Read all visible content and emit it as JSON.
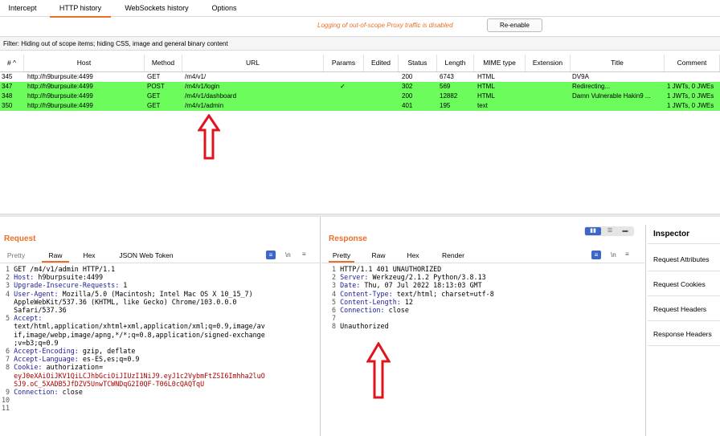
{
  "tabs": [
    "Intercept",
    "HTTP history",
    "WebSockets history",
    "Options"
  ],
  "info": {
    "warning": "Logging of out-of-scope Proxy traffic is disabled",
    "reenable": "Re-enable"
  },
  "filter": "Filter: Hiding out of scope items;  hiding CSS, image and general binary content",
  "columns": [
    "# ^",
    "Host",
    "Method",
    "URL",
    "Params",
    "Edited",
    "Status",
    "Length",
    "MIME type",
    "Extension",
    "Title",
    "Comment"
  ],
  "rows": [
    {
      "num": "345",
      "host": "http://h9burpsuite:4499",
      "method": "GET",
      "url": "/m4/v1/",
      "params": "",
      "edited": "",
      "status": "200",
      "length": "6743",
      "mime": "HTML",
      "ext": "",
      "title": "DV9A",
      "comment": ""
    },
    {
      "num": "347",
      "host": "http://h9burpsuite:4499",
      "method": "POST",
      "url": "/m4/v1/login",
      "params": "✓",
      "edited": "",
      "status": "302",
      "length": "569",
      "mime": "HTML",
      "ext": "",
      "title": "Redirecting...",
      "comment": "1 JWTs, 0 JWEs"
    },
    {
      "num": "348",
      "host": "http://h9burpsuite:4499",
      "method": "GET",
      "url": "/m4/v1/dashboard",
      "params": "",
      "edited": "",
      "status": "200",
      "length": "12882",
      "mime": "HTML",
      "ext": "",
      "title": "Damn Vulnerable Hakin9 ...",
      "comment": "1 JWTs, 0 JWEs"
    },
    {
      "num": "350",
      "host": "http://h9burpsuite:4499",
      "method": "GET",
      "url": "/m4/v1/admin",
      "params": "",
      "edited": "",
      "status": "401",
      "length": "195",
      "mime": "text",
      "ext": "",
      "title": "",
      "comment": "1 JWTs, 0 JWEs"
    }
  ],
  "request": {
    "title": "Request",
    "tabs": [
      "Pretty",
      "Raw",
      "Hex",
      "JSON Web Token"
    ],
    "newline_label": "\\n",
    "menu_glyph": "≡",
    "lines": [
      {
        "n": "1",
        "k": "",
        "v": "GET /m4/v1/admin HTTP/1.1"
      },
      {
        "n": "2",
        "k": "Host:",
        "v": " h9burpsuite:4499"
      },
      {
        "n": "3",
        "k": "Upgrade-Insecure-Requests:",
        "v": " 1"
      },
      {
        "n": "4",
        "k": "User-Agent:",
        "v": " Mozilla/5.0 (Macintosh; Intel Mac OS X 10_15_7)"
      },
      {
        "n": "",
        "k": "",
        "v": "AppleWebKit/537.36 (KHTML, like Gecko) Chrome/103.0.0.0"
      },
      {
        "n": "",
        "k": "",
        "v": "Safari/537.36"
      },
      {
        "n": "5",
        "k": "Accept:",
        "v": ""
      },
      {
        "n": "",
        "k": "",
        "v": "text/html,application/xhtml+xml,application/xml;q=0.9,image/av"
      },
      {
        "n": "",
        "k": "",
        "v": "if,image/webp,image/apng,*/*;q=0.8,application/signed-exchange"
      },
      {
        "n": "",
        "k": "",
        "v": ";v=b3;q=0.9"
      },
      {
        "n": "6",
        "k": "Accept-Encoding:",
        "v": " gzip, deflate"
      },
      {
        "n": "7",
        "k": "Accept-Language:",
        "v": " es-ES,es;q=0.9"
      },
      {
        "n": "8",
        "k": "Cookie:",
        "v": " authorization="
      },
      {
        "n": "",
        "k": "",
        "v": "eyJ0eXAiOiJKV1QiLCJhbGciOiJIUzI1NiJ9.eyJ1c2VybmFtZSI6Imhha2luO",
        "red": true
      },
      {
        "n": "",
        "k": "",
        "v": "SJ9.oC_5XADB5JfDZV5UnwTCWNDqG2I0QF-T06L0cQAQTqU",
        "red": true
      },
      {
        "n": "9",
        "k": "Connection:",
        "v": " close"
      },
      {
        "n": "10",
        "k": "",
        "v": ""
      },
      {
        "n": "11",
        "k": "",
        "v": ""
      }
    ]
  },
  "response": {
    "title": "Response",
    "tabs": [
      "Pretty",
      "Raw",
      "Hex",
      "Render"
    ],
    "newline_label": "\\n",
    "menu_glyph": "≡",
    "lines": [
      {
        "n": "1",
        "k": "",
        "v": "HTTP/1.1 401 UNAUTHORIZED"
      },
      {
        "n": "2",
        "k": "Server:",
        "v": " Werkzeug/2.1.2 Python/3.8.13"
      },
      {
        "n": "3",
        "k": "Date:",
        "v": " Thu, 07 Jul 2022 18:13:03 GMT"
      },
      {
        "n": "4",
        "k": "Content-Type:",
        "v": " text/html; charset=utf-8"
      },
      {
        "n": "5",
        "k": "Content-Length:",
        "v": " 12"
      },
      {
        "n": "6",
        "k": "Connection:",
        "v": " close"
      },
      {
        "n": "7",
        "k": "",
        "v": ""
      },
      {
        "n": "8",
        "k": "",
        "v": "Unauthorized"
      }
    ]
  },
  "inspector": {
    "title": "Inspector",
    "items": [
      "Request Attributes",
      "Request Cookies",
      "Request Headers",
      "Response Headers"
    ]
  },
  "colors": {
    "accent": "#e8702a",
    "highlight": "#6cfc5c",
    "arrow": "#e0141e",
    "key": "#1c1c9c",
    "token": "#aa0000"
  }
}
